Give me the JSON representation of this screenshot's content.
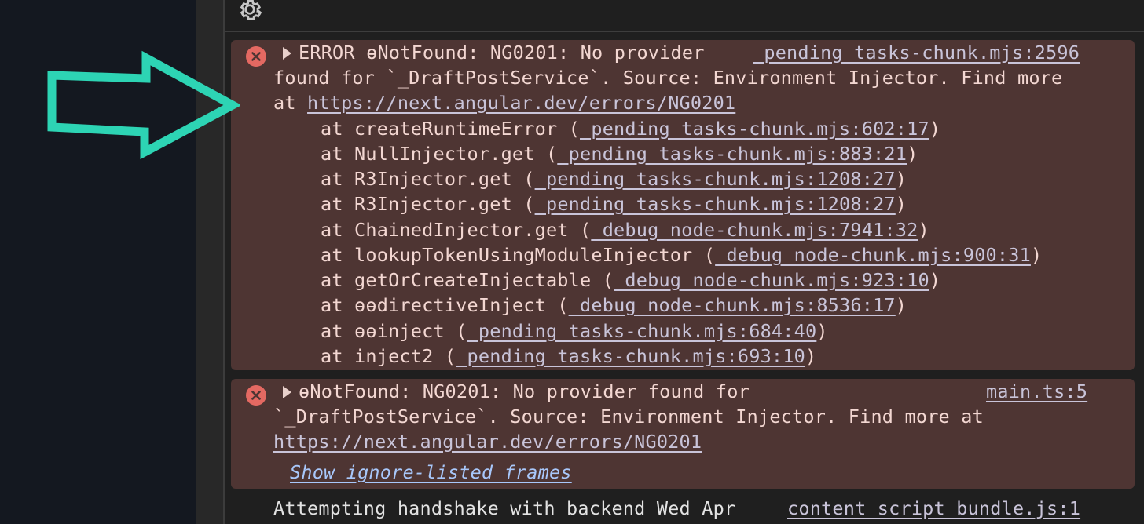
{
  "toolbar": {
    "settings_icon": "gear-icon"
  },
  "messages": [
    {
      "icon": "error-circle-icon",
      "prefix": "ERROR ",
      "text_line1": "ɵNotFound: NG0201: No provider",
      "source": "_pending_tasks-chunk.mjs:2596",
      "text_line2": "found for `_DraftPostService`. Source: Environment Injector. Find more",
      "text_line3_prefix": "at ",
      "url": "https://next.angular.dev/errors/NG0201",
      "stack": [
        {
          "fn": "at createRuntimeError (",
          "loc": "_pending_tasks-chunk.mjs:602:17",
          "close": ")"
        },
        {
          "fn": "at NullInjector.get (",
          "loc": "_pending_tasks-chunk.mjs:883:21",
          "close": ")"
        },
        {
          "fn": "at R3Injector.get (",
          "loc": "_pending_tasks-chunk.mjs:1208:27",
          "close": ")"
        },
        {
          "fn": "at R3Injector.get (",
          "loc": "_pending_tasks-chunk.mjs:1208:27",
          "close": ")"
        },
        {
          "fn": "at ChainedInjector.get (",
          "loc": "_debug_node-chunk.mjs:7941:32",
          "close": ")"
        },
        {
          "fn": "at lookupTokenUsingModuleInjector (",
          "loc": "_debug_node-chunk.mjs:900:31",
          "close": ")"
        },
        {
          "fn": "at getOrCreateInjectable (",
          "loc": "_debug_node-chunk.mjs:923:10",
          "close": ")"
        },
        {
          "fn": "at ɵɵdirectiveInject (",
          "loc": "_debug_node-chunk.mjs:8536:17",
          "close": ")"
        },
        {
          "fn": "at ɵɵinject (",
          "loc": "_pending_tasks-chunk.mjs:684:40",
          "close": ")"
        },
        {
          "fn": "at inject2 (",
          "loc": "_pending_tasks-chunk.mjs:693:10",
          "close": ")"
        }
      ]
    },
    {
      "icon": "error-circle-icon",
      "text_line1": "ɵNotFound: NG0201: No provider found for",
      "source": "main.ts:5",
      "text_line2": "`_DraftPostService`. Source: Environment Injector. Find more at",
      "url": "https://next.angular.dev/errors/NG0201",
      "show_frames": "Show ignore-listed frames"
    }
  ],
  "info": {
    "text": "Attempting handshake with backend Wed Apr",
    "source": "content_script_bundle.js:1"
  },
  "colors": {
    "error_bg": "#4e3533",
    "error_icon": "#e46962",
    "annotation_arrow": "#2dd4b4"
  }
}
